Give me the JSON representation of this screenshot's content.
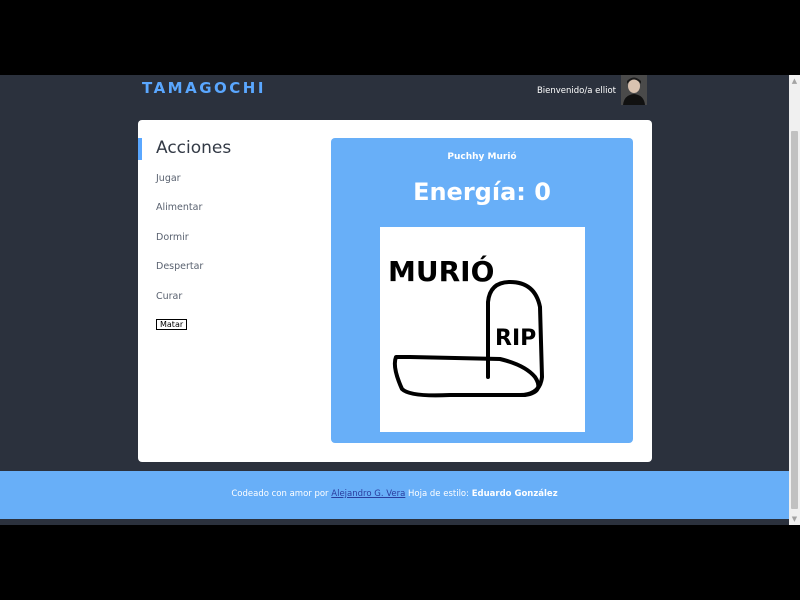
{
  "header": {
    "brand": "TAMAGOCHI",
    "welcome": "Bienvenido/a elliot",
    "avatar_icon": "user-avatar-photo"
  },
  "sidebar": {
    "title": "Acciones",
    "items": [
      {
        "label": "Jugar"
      },
      {
        "label": "Alimentar"
      },
      {
        "label": "Dormir"
      },
      {
        "label": "Despertar"
      },
      {
        "label": "Curar"
      }
    ],
    "kill_button": "Matar"
  },
  "pet": {
    "status": "Puchhy Murió",
    "energy": "Energía: 0",
    "image_text": [
      "MURIÓ",
      "RIP"
    ]
  },
  "footer": {
    "prefix": "Codeado con amor por",
    "author": "Alejandro G. Vera",
    "middle": "Hoja de estilo:",
    "stylist": "Eduardo González"
  },
  "colors": {
    "accent": "#5aa7ff",
    "panel": "#68aff8",
    "background": "#2b313d"
  }
}
